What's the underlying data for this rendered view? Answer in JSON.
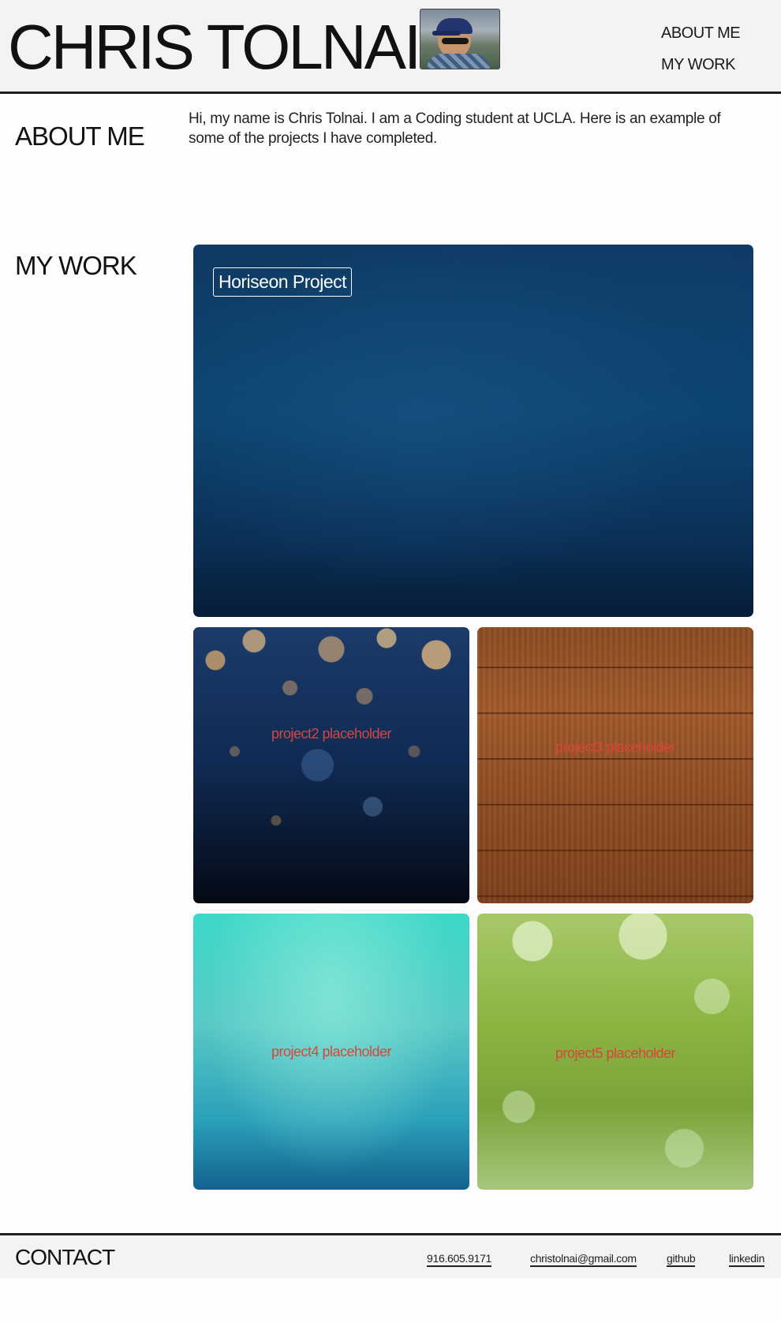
{
  "header": {
    "title": "CHRIS TOLNAI",
    "nav": [
      {
        "label": "ABOUT ME"
      },
      {
        "label": "MY WORK"
      }
    ]
  },
  "about": {
    "heading": "ABOUT ME",
    "text": "Hi, my name is Chris Tolnai. I am a Coding student at UCLA. Here is an example of some of the projects I have completed."
  },
  "work": {
    "heading": "MY WORK",
    "projects": [
      {
        "label": "Horiseon Project"
      },
      {
        "label": "project2 placeholder"
      },
      {
        "label": "project3 placeholder"
      },
      {
        "label": "project4 placeholder"
      },
      {
        "label": "project5 placeholder"
      }
    ]
  },
  "footer": {
    "heading": "CONTACT",
    "links": [
      {
        "label": "916.605.9171"
      },
      {
        "label": "christolnai@gmail.com"
      },
      {
        "label": "github"
      },
      {
        "label": "linkedin"
      }
    ]
  },
  "colors": {
    "header_bg": "#f3f3f3",
    "rule": "#1f1f1f",
    "placeholder_text": "#d8453d"
  }
}
